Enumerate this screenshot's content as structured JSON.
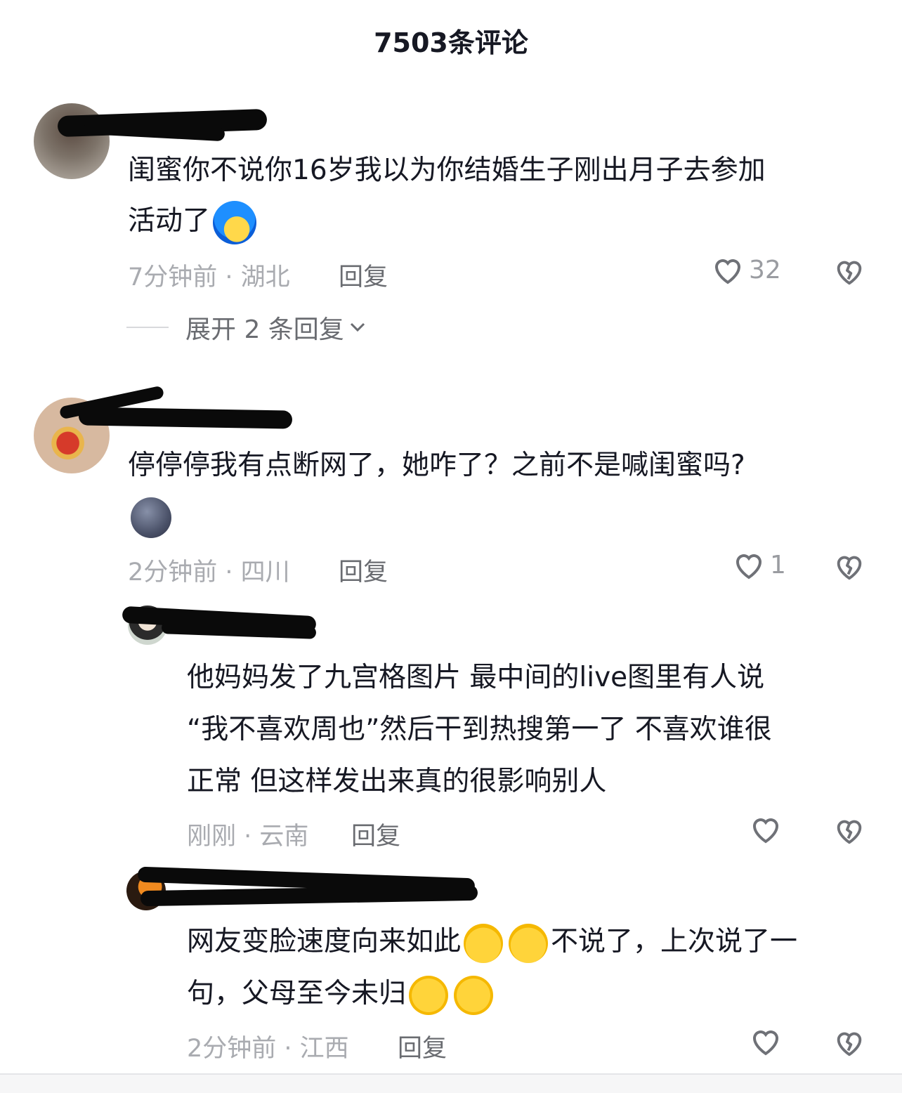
{
  "header": {
    "title": "7503条评论"
  },
  "comments": [
    {
      "text_line1": "闺蜜你不说你16岁我以为你结婚生子刚出月子去参加",
      "text_line2": "活动了",
      "time_location": "7分钟前 · 湖北",
      "reply_label": "回复",
      "likes": "32",
      "expand_label": "展开 2 条回复"
    },
    {
      "text_line1": "停停停我有点断网了，她咋了？之前不是喊闺蜜吗?",
      "time_location": "2分钟前 · 四川",
      "reply_label": "回复",
      "likes": "1"
    },
    {
      "text_line1": "他妈妈发了九宫格图片 最中间的live图里有人说",
      "text_line2": "“我不喜欢周也”然后干到热搜第一了 不喜欢谁很",
      "text_line3": "正常 但这样发出来真的很影响别人",
      "time_location": "刚刚 · 云南",
      "reply_label": "回复",
      "likes": ""
    },
    {
      "text_line1": "网友变脸速度向来如此",
      "text_line1b": "不说了，上次说了一",
      "text_line2": "句，父母至今未归",
      "time_location": "2分钟前 · 江西",
      "reply_label": "回复",
      "likes": ""
    }
  ],
  "icons": {
    "like": "heart-outline-icon",
    "dislike": "broken-heart-icon",
    "expand": "chevron-down-icon"
  },
  "colors": {
    "text_primary": "#161823",
    "text_meta": "#a9abb0",
    "text_reply": "#6a6c71",
    "icon_gray": "#6f7177"
  }
}
